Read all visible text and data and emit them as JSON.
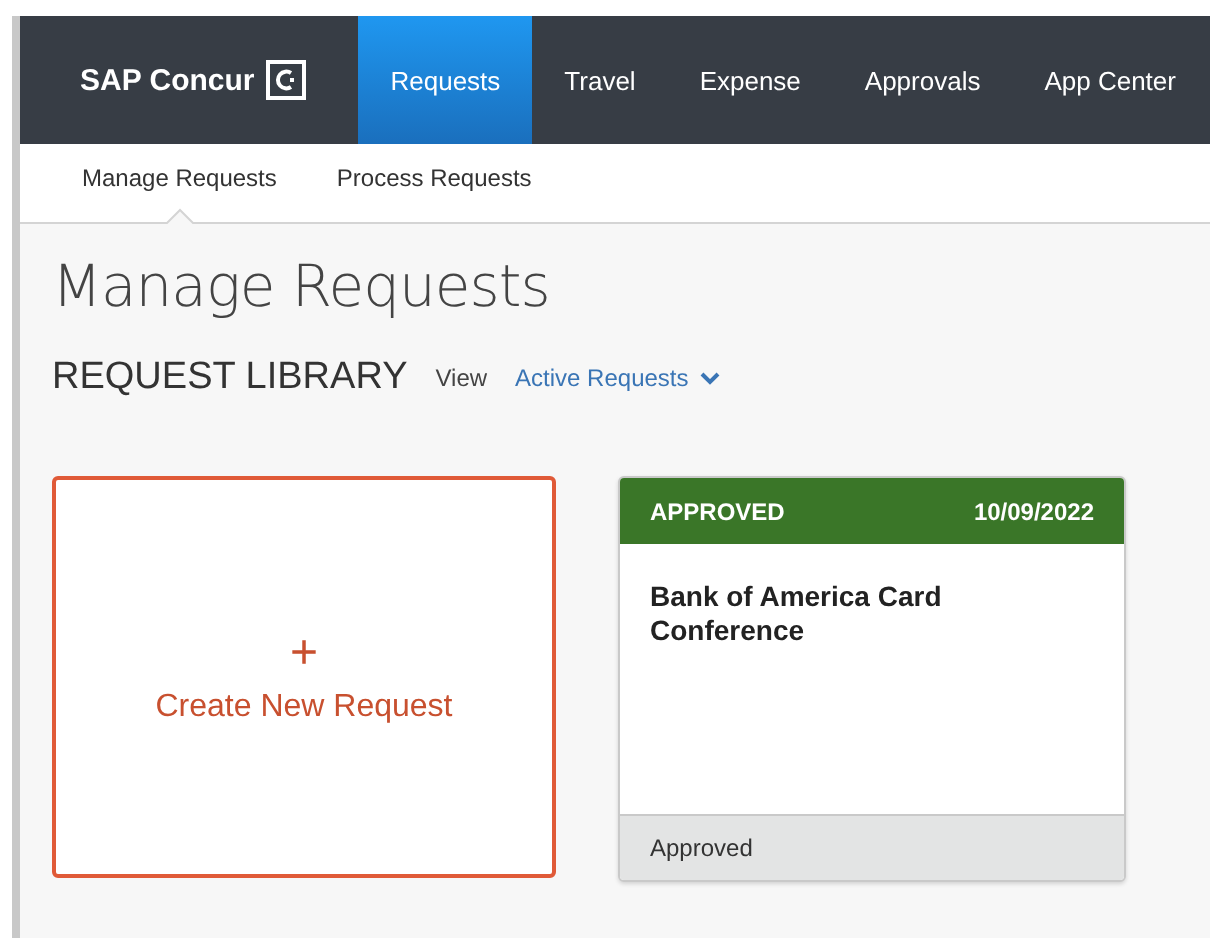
{
  "brand": {
    "name": "SAP Concur"
  },
  "nav": [
    {
      "label": "Requests",
      "selected": true
    },
    {
      "label": "Travel",
      "selected": false
    },
    {
      "label": "Expense",
      "selected": false
    },
    {
      "label": "Approvals",
      "selected": false
    },
    {
      "label": "App Center",
      "selected": false
    }
  ],
  "subnav": [
    {
      "label": "Manage Requests",
      "selected": true
    },
    {
      "label": "Process Requests",
      "selected": false
    }
  ],
  "page_title": "Manage Requests",
  "library": {
    "heading": "REQUEST LIBRARY",
    "view_label": "View",
    "filter": "Active Requests"
  },
  "create_card": {
    "icon": "+",
    "label": "Create New Request"
  },
  "requests": [
    {
      "status": "APPROVED",
      "date": "10/09/2022",
      "title": "Bank of America Card Conference",
      "footer": "Approved",
      "color": "#3a7628"
    }
  ]
}
